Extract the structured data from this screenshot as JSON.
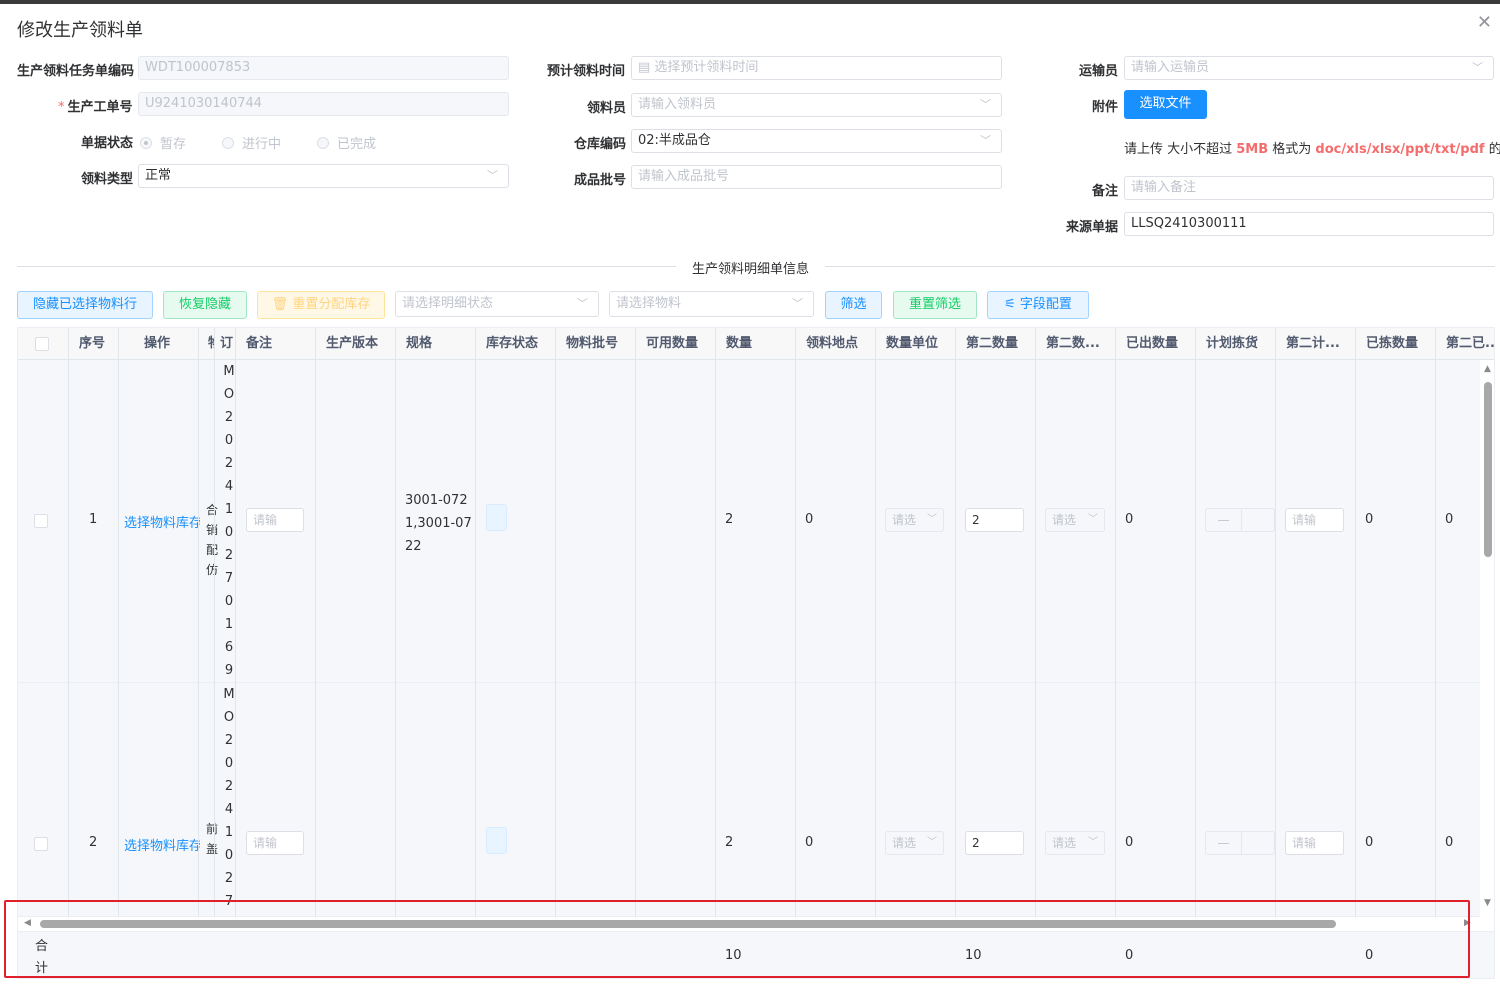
{
  "dialog": {
    "title": "修改生产领料单"
  },
  "form": {
    "task_code": {
      "label": "生产领料任务单编码",
      "value": "WDT100007853"
    },
    "work_order": {
      "required_mark": "*",
      "label": "生产工单号",
      "value": "U9241030140744"
    },
    "doc_status": {
      "label": "单据状态",
      "options": [
        "暂存",
        "进行中",
        "已完成"
      ],
      "selected": "暂存"
    },
    "pick_type": {
      "label": "领料类型",
      "value": "正常"
    },
    "plan_time": {
      "label": "预计领料时间",
      "placeholder": "选择预计领料时间"
    },
    "picker": {
      "label": "领料员",
      "placeholder": "请输入领料员"
    },
    "warehouse": {
      "label": "仓库编码",
      "value": "02:半成品仓"
    },
    "product_batch": {
      "label": "成品批号",
      "placeholder": "请输入成品批号"
    },
    "transporter": {
      "label": "运输员",
      "placeholder": "请输入运输员"
    },
    "attachment": {
      "label": "附件",
      "button": "选取文件"
    },
    "upload_hint": {
      "prefix": "请上传 大小不超过 ",
      "size": "5MB",
      "middle": " 格式为 ",
      "formats": "doc/xls/xlsx/ppt/txt/pdf",
      "suffix": " 的文件"
    },
    "remark": {
      "label": "备注",
      "placeholder": "请输入备注"
    },
    "source_doc": {
      "label": "来源单据",
      "value": "LLSQ2410300111"
    }
  },
  "section": {
    "title": "生产领料明细单信息"
  },
  "toolbar": {
    "hide_selected": "隐藏已选择物料行",
    "restore_hidden": "恢复隐藏",
    "realloc": "重置分配库存",
    "detail_status_ph": "请选择明细状态",
    "material_ph": "请选择物料",
    "filter": "筛选",
    "reset_filter": "重置筛选",
    "field_config": "字段配置"
  },
  "table": {
    "headers": [
      "序号",
      "操作",
      "物",
      "订",
      "备注",
      "生产版本",
      "规格",
      "库存状态",
      "物料批号",
      "可用数量",
      "数量",
      "领料地点",
      "数量单位",
      "第二数量",
      "第二数...",
      "已出数量",
      "计划拣货",
      "第二计...",
      "已拣数量",
      "第二已..."
    ],
    "rows": [
      {
        "seq": "1",
        "action": "选择物料库存",
        "material_frag": "合\n销\n配\n仿",
        "order_chars": [
          "M",
          "O",
          "2",
          "0",
          "2",
          "4",
          "1",
          "0",
          "2",
          "7",
          "0",
          "1",
          "6",
          "9"
        ],
        "remark_ph": "请输",
        "spec": [
          "3001-072",
          "1,3001-07",
          "22"
        ],
        "qty": "2",
        "pick_loc": "0",
        "unit_ph": "请选",
        "second_qty": "2",
        "second_unit_ph": "请选",
        "shipped": "0",
        "plan_pick": "—",
        "second_plan_ph": "请输",
        "picked": "0",
        "second_picked": "0"
      },
      {
        "seq": "2",
        "action": "选择物料库存",
        "material_frag": "前\n盖",
        "order_chars": [
          "M",
          "O",
          "2",
          "0",
          "2",
          "4",
          "1",
          "0",
          "2",
          "7"
        ],
        "remark_ph": "请输",
        "spec": [],
        "qty": "2",
        "pick_loc": "0",
        "unit_ph": "请选",
        "second_qty": "2",
        "second_unit_ph": "请选",
        "shipped": "0",
        "plan_pick": "—",
        "second_plan_ph": "请输",
        "picked": "0",
        "second_picked": "0"
      }
    ],
    "summary": {
      "label_1": "合",
      "label_2": "计",
      "qty": "10",
      "second_qty": "10",
      "shipped": "0",
      "picked": "0"
    }
  },
  "colors": {
    "accent": "#1890ff",
    "success": "#13ce66",
    "warning": "#ffd480",
    "danger": "#f56c6c",
    "highlight_box": "#e0202a"
  }
}
